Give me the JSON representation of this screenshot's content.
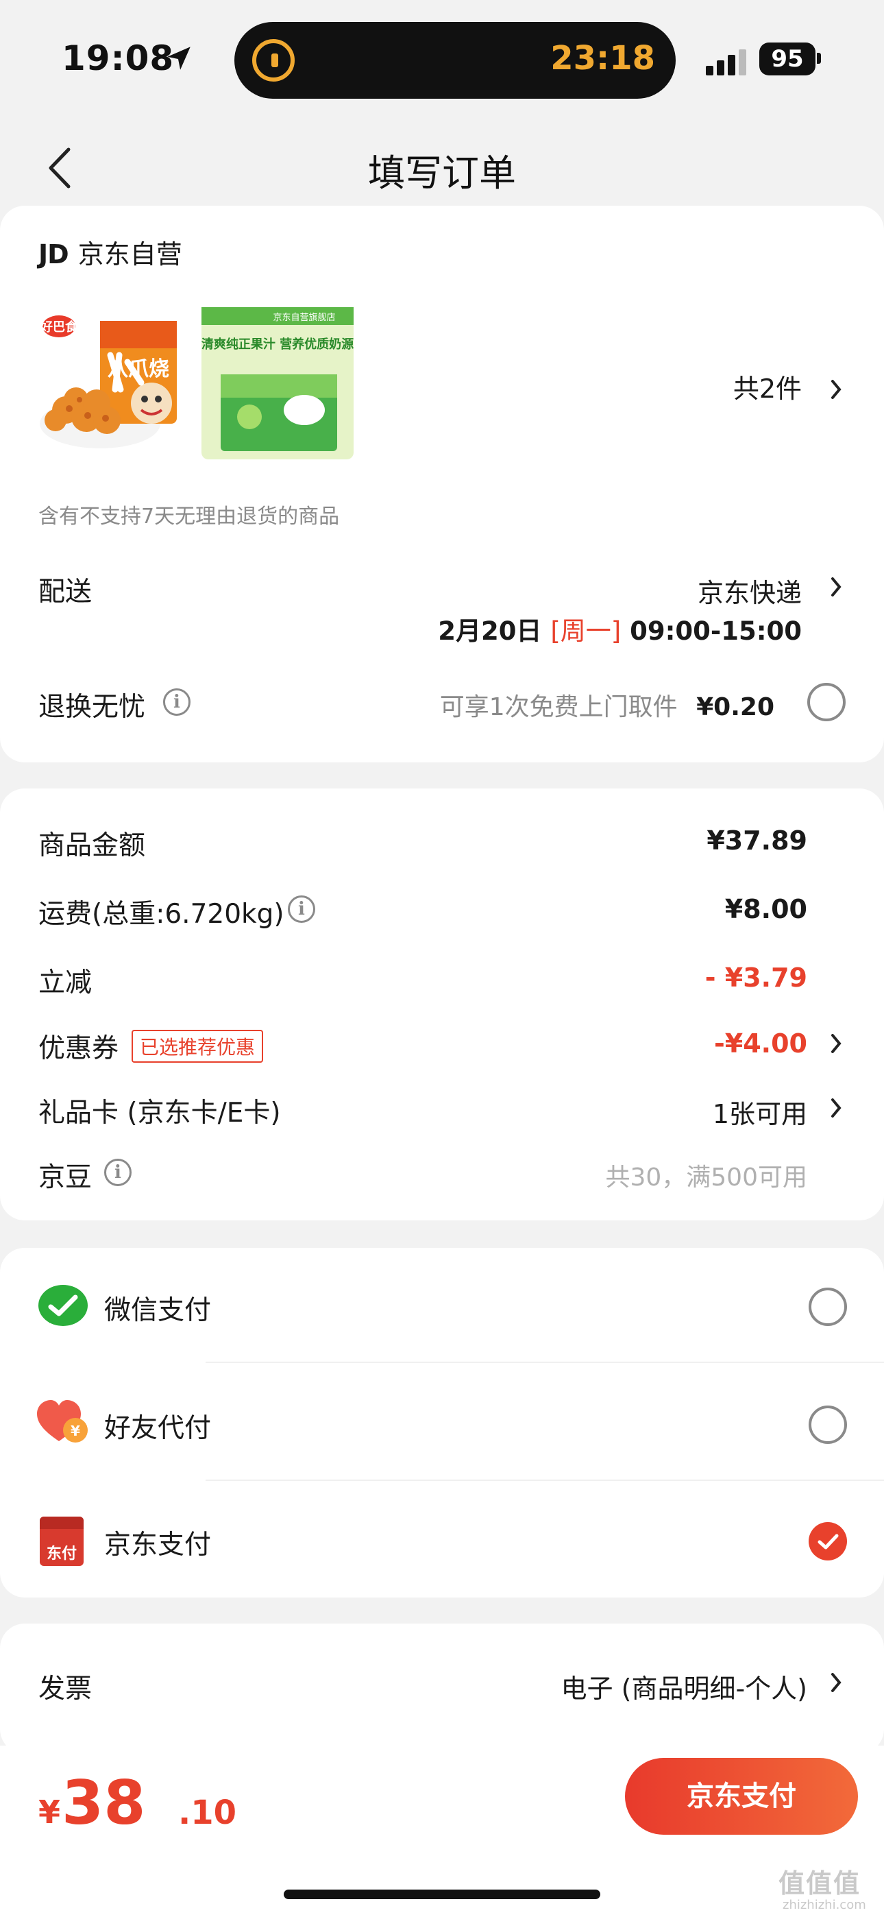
{
  "status_bar": {
    "time": "19:08",
    "island_time": "23:18",
    "battery": "95"
  },
  "header": {
    "title": "填写订单"
  },
  "shop": {
    "logo_text": "JD",
    "name": "京东自营",
    "quantity": "共2件",
    "notice": "含有不支持7天无理由退货的商品",
    "products": [
      {
        "image_caption": "八爪烧",
        "brand_mark": "好巴食"
      },
      {
        "image_caption": "清爽纯正果汁 营养优质奶源",
        "store_mark": "京东自营旗舰店"
      }
    ]
  },
  "delivery": {
    "label": "配送",
    "method": "京东快递",
    "date": "2月20日",
    "weekday": "[周一]",
    "time_window": "09:00-15:00"
  },
  "return_service": {
    "label": "退换无忧",
    "desc": "可享1次免费上门取件",
    "price": "¥0.20"
  },
  "summary": {
    "goods_label": "商品金额",
    "goods_value": "¥37.89",
    "shipping_label": "运费(总重:6.720kg)",
    "shipping_value": "¥8.00",
    "discount_label": "立减",
    "discount_value": "- ¥3.79",
    "coupon_label": "优惠券",
    "coupon_badge": "已选推荐优惠",
    "coupon_value": "-¥4.00",
    "giftcard_label": "礼品卡 (京东卡/E卡)",
    "giftcard_value": "1张可用",
    "jingdou_label": "京豆",
    "jingdou_value": "共30，满500可用"
  },
  "payment": {
    "options": [
      {
        "label": "微信支付",
        "icon": "wechat-pay-icon",
        "selected": false
      },
      {
        "label": "好友代付",
        "icon": "friend-pay-heart-icon",
        "selected": false
      },
      {
        "label": "京东支付",
        "icon": "jd-pay-icon",
        "icon_text": "东付",
        "selected": true
      }
    ]
  },
  "invoice": {
    "label": "发票",
    "value": "电子 (商品明细-个人)"
  },
  "bottom": {
    "currency": "¥",
    "total_int": "38",
    "total_dec": ".10",
    "pay_button": "京东支付"
  },
  "watermark": {
    "main": "值值值",
    "sub": "zhizhizhi.com"
  },
  "colors": {
    "accent_red": "#e8412c",
    "wechat_green": "#2aae3a",
    "island_orange": "#f0a830"
  }
}
